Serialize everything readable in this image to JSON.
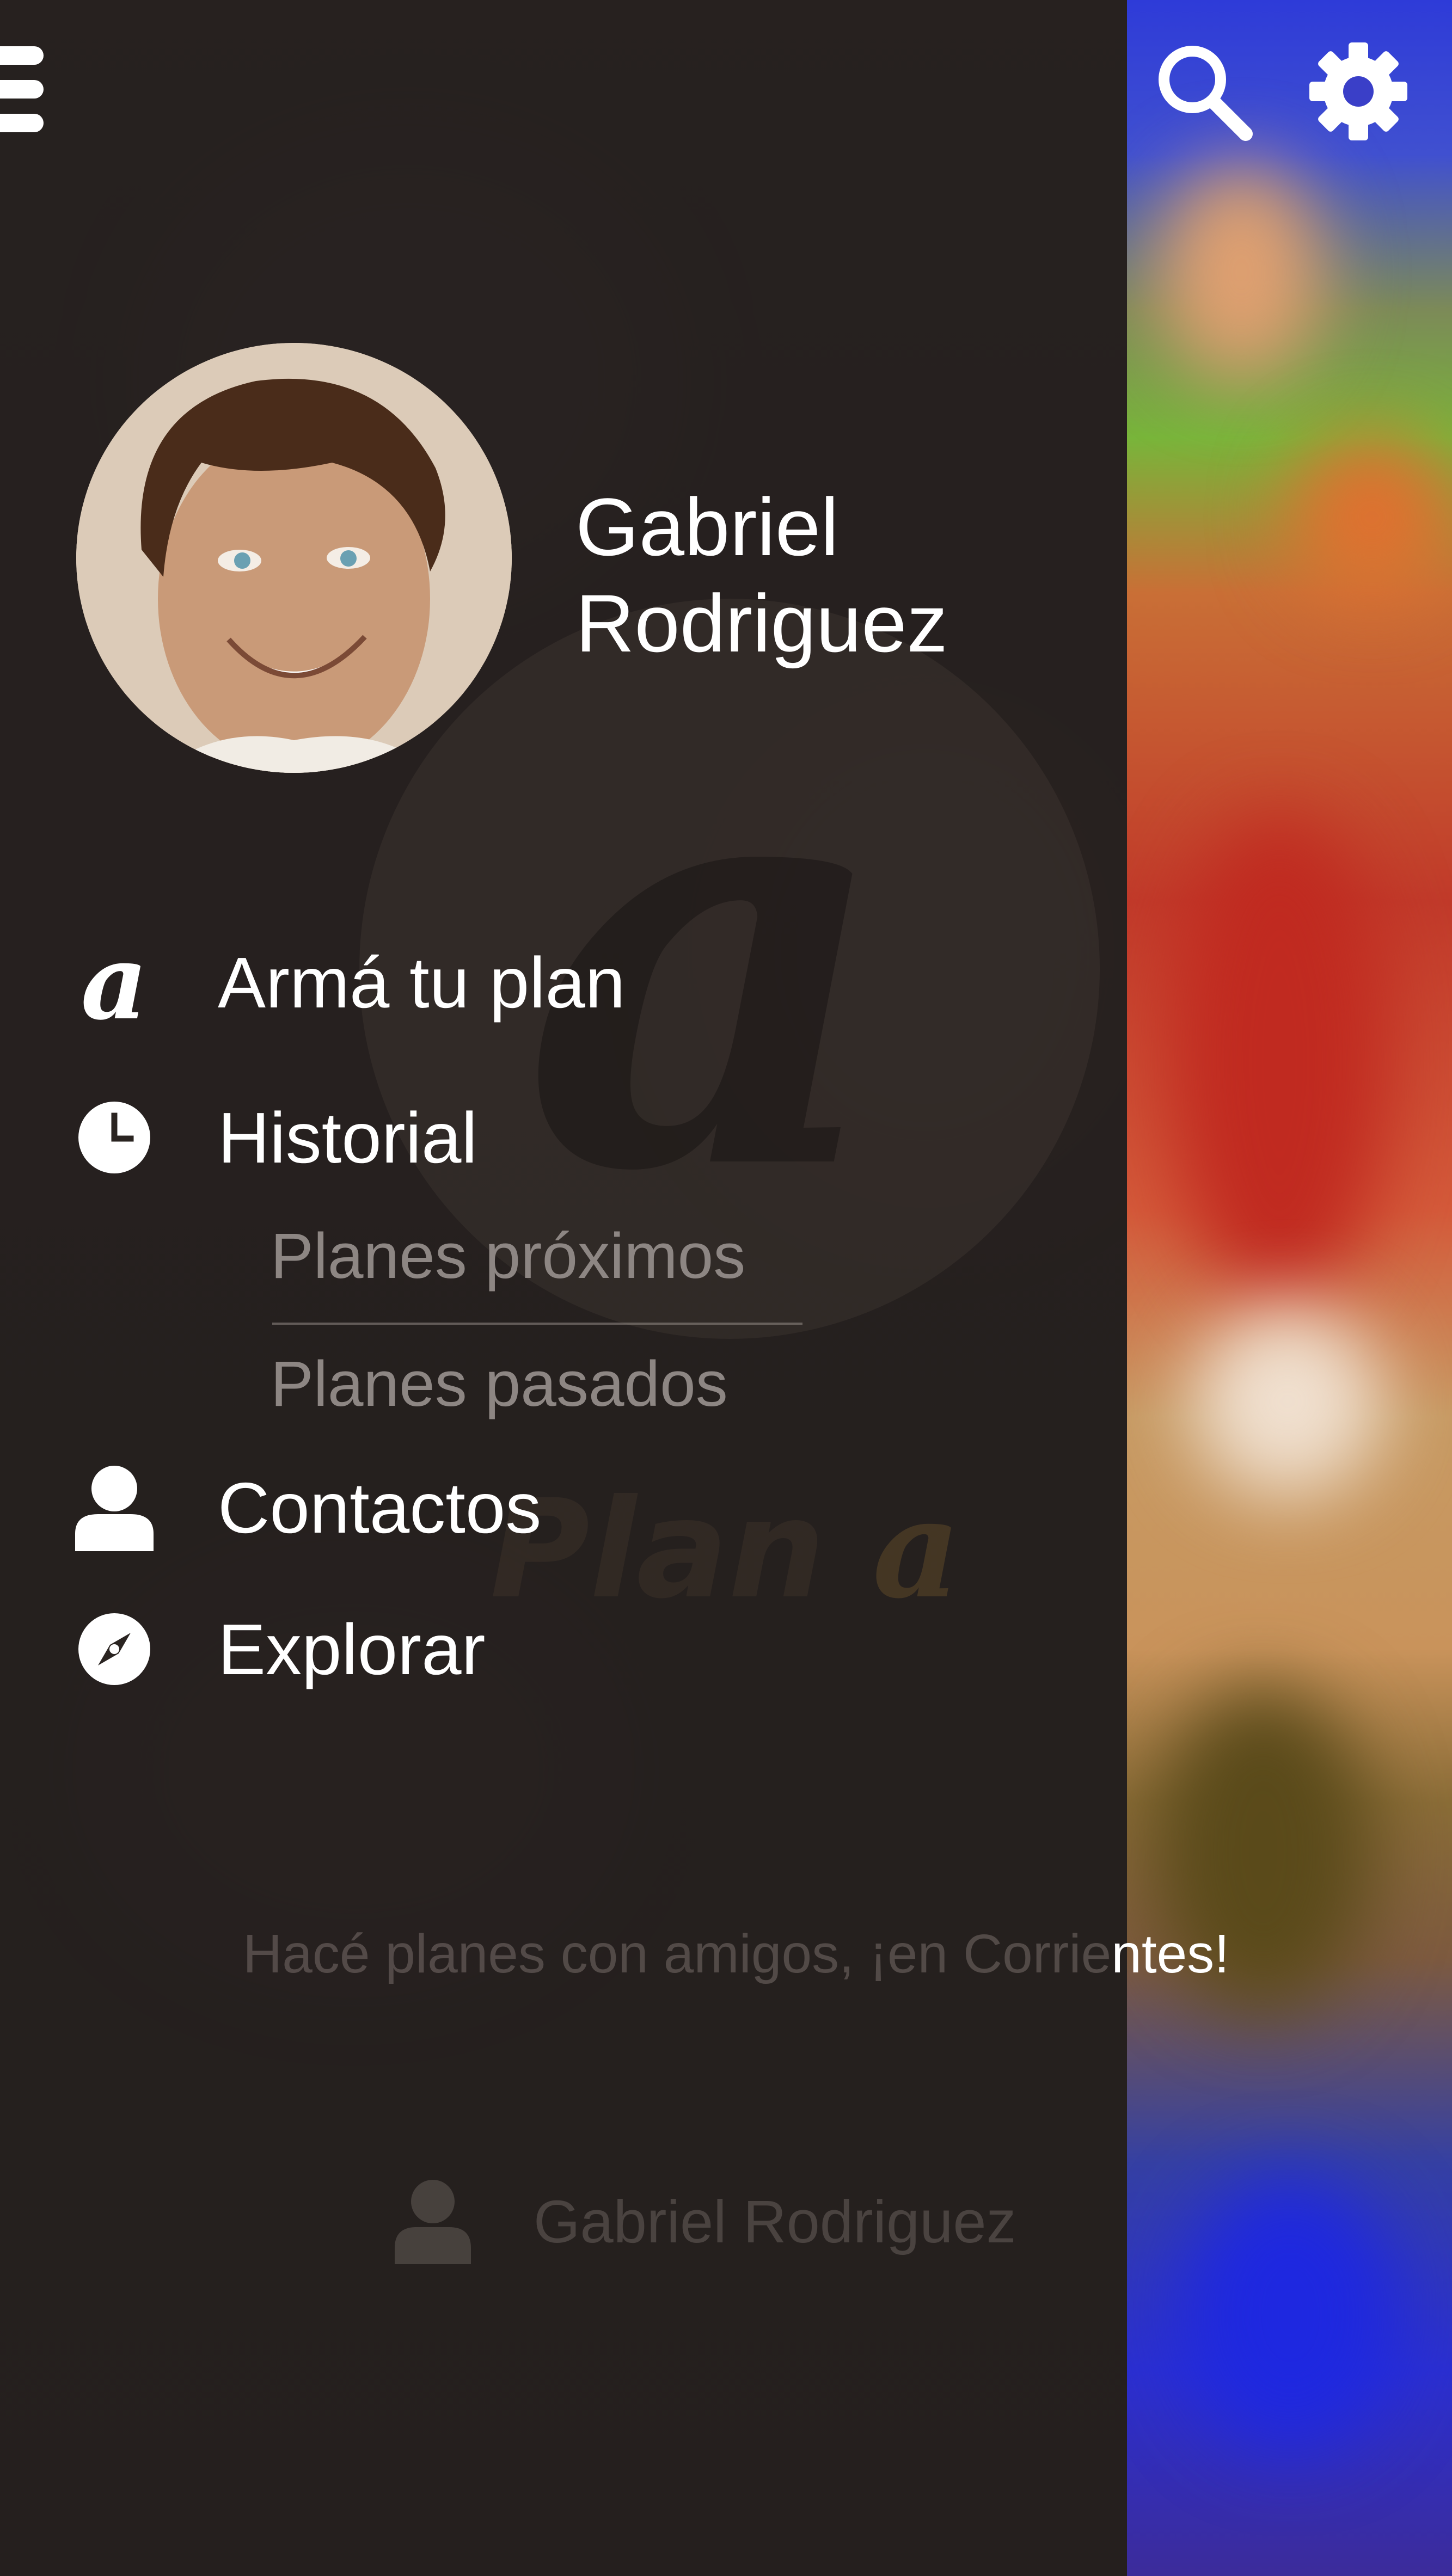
{
  "profile": {
    "first_name": "Gabriel",
    "last_name": "Rodriguez"
  },
  "menu": {
    "items": [
      {
        "label": "Armá tu plan",
        "icon": "plan-a-logo-icon"
      },
      {
        "label": "Historial",
        "icon": "clock-icon"
      },
      {
        "label": "Contactos",
        "icon": "person-icon"
      },
      {
        "label": "Explorar",
        "icon": "compass-icon"
      }
    ],
    "historial_sub": [
      {
        "label": "Planes próximos"
      },
      {
        "label": "Planes pasados"
      }
    ]
  },
  "background": {
    "brand_word": "Plan",
    "brand_mark": "a",
    "tagline_dim": "Hacé planes con amigos, ¡en Corrie",
    "tagline_visible": "ntes!",
    "user_name": "Gabriel Rodriguez"
  },
  "icons": {
    "menu": "hamburger-menu-icon",
    "search": "search-icon",
    "settings": "gear-icon"
  },
  "colors": {
    "drawer": "#26211f",
    "text": "#ffffff",
    "submenu_text": "#8d8683"
  }
}
